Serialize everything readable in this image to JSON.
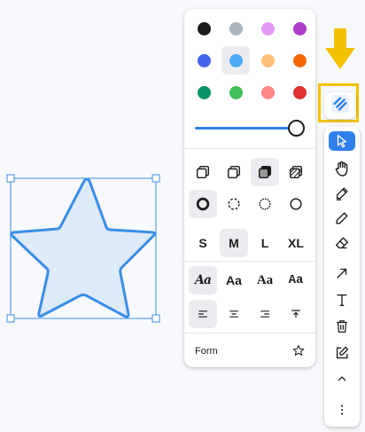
{
  "colors": {
    "accent": "#2f80ed",
    "hint": "#f2c200",
    "shape_stroke": "#3a8ee6",
    "shape_fill": "#ddeaf8",
    "selection": "#3a8ee6"
  },
  "palette": {
    "swatches": [
      {
        "name": "black",
        "color": "#1d1d1d",
        "selected": false
      },
      {
        "name": "grey",
        "color": "#adb5bd",
        "selected": false
      },
      {
        "name": "light-violet",
        "color": "#e599f7",
        "selected": false
      },
      {
        "name": "violet",
        "color": "#ae3ec9",
        "selected": false
      },
      {
        "name": "blue",
        "color": "#4263eb",
        "selected": false
      },
      {
        "name": "light-blue",
        "color": "#4dabf7",
        "selected": true
      },
      {
        "name": "yellow",
        "color": "#ffc078",
        "selected": false
      },
      {
        "name": "orange",
        "color": "#f76707",
        "selected": false
      },
      {
        "name": "green",
        "color": "#099268",
        "selected": false
      },
      {
        "name": "light-green",
        "color": "#40c057",
        "selected": false
      },
      {
        "name": "light-red",
        "color": "#ff8787",
        "selected": false
      },
      {
        "name": "red",
        "color": "#e03131",
        "selected": false
      }
    ],
    "opacity": 1
  },
  "fill_options": [
    {
      "icon": "fill-none-icon",
      "selected": false
    },
    {
      "icon": "fill-semi-icon",
      "selected": false
    },
    {
      "icon": "fill-solid-icon",
      "selected": true
    },
    {
      "icon": "fill-pattern-icon",
      "selected": false
    }
  ],
  "dash_options": [
    {
      "icon": "dash-draw-icon",
      "selected": true
    },
    {
      "icon": "dash-dashed-icon",
      "selected": false
    },
    {
      "icon": "dash-dotted-icon",
      "selected": false
    },
    {
      "icon": "dash-solid-icon",
      "selected": false
    }
  ],
  "size_options": [
    {
      "label": "S",
      "selected": false
    },
    {
      "label": "M",
      "selected": true
    },
    {
      "label": "L",
      "selected": false
    },
    {
      "label": "XL",
      "selected": false
    }
  ],
  "font_options": [
    {
      "label": "Aa",
      "style": "draw",
      "selected": true
    },
    {
      "label": "Aa",
      "style": "sans",
      "selected": false
    },
    {
      "label": "Aa",
      "style": "serif",
      "selected": false
    },
    {
      "label": "Aa",
      "style": "mono",
      "selected": false
    }
  ],
  "align_options": [
    {
      "icon": "align-left-icon",
      "selected": true
    },
    {
      "icon": "align-center-icon",
      "selected": false
    },
    {
      "icon": "align-right-icon",
      "selected": false
    },
    {
      "icon": "align-top-icon",
      "selected": false
    }
  ],
  "form": {
    "label": "Form",
    "icon": "star-outline-icon"
  },
  "toolbar": {
    "style_button_icon": "style-brush-icon",
    "tools": [
      {
        "icon": "select-cursor-icon",
        "active": true
      },
      {
        "icon": "hand-icon",
        "active": false
      },
      {
        "icon": "draw-pen-icon",
        "active": false
      },
      {
        "icon": "pencil-icon",
        "active": false
      },
      {
        "icon": "eraser-icon",
        "active": false
      },
      {
        "icon": "arrow-icon",
        "active": false
      },
      {
        "icon": "text-icon",
        "active": false
      },
      {
        "icon": "trash-icon",
        "active": false
      },
      {
        "icon": "edit-note-icon",
        "active": false
      },
      {
        "icon": "chevron-up-icon",
        "active": false
      },
      {
        "icon": "more-vertical-icon",
        "active": false
      }
    ]
  }
}
